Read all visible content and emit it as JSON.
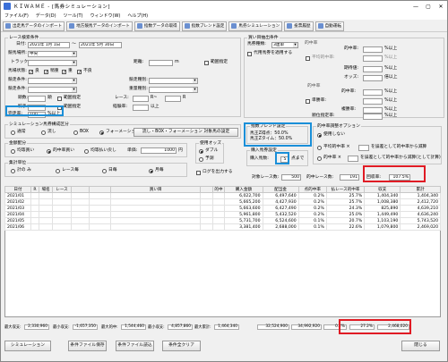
{
  "window": {
    "title": "ＫＩＷＡＭＥ - [馬券シミュレーション]",
    "controls": [
      "—",
      "▢",
      "✕"
    ]
  },
  "menu": [
    "ファイル(F)",
    "データ(D)",
    "ツール(T)",
    "ウィンドウ(W)",
    "ヘルプ(H)"
  ],
  "toolbar": [
    "出走馬データのインポート",
    "地方競馬データのインポート",
    "指数データの取得",
    "指数ブレンド設定",
    "馬券シミュレーション",
    "投票履歴",
    "自動運転"
  ],
  "race": {
    "caption": "レース検索条件",
    "date_label": "日付:",
    "date_from": "2021年 1月 1日",
    "date_to": "2021年 5月 30日",
    "venue_label": "競馬場所:",
    "venue": "中央",
    "track_label": "トラック:",
    "distance_label": "距離:",
    "distance_unit": "m",
    "range": "範囲指定",
    "cond_label": "馬場状態:",
    "cond": [
      "良",
      "稍重",
      "重",
      "不良"
    ],
    "class_label": "競走条件:",
    "grade_label": "競走種別:",
    "weight_label": "重量種別:",
    "age_label": "競走条件:",
    "count_label": "頭数:",
    "head_unit": "頭",
    "race_label": "レース:",
    "race_unit": "R",
    "dash": "R~",
    "jockey_label": "騎手:",
    "jockey_unit": "以上",
    "rest_label": "経験率:",
    "rest_unit": "以上",
    "settle_label": "完走率:",
    "settle_val": "100",
    "settle_unit": "%以上"
  },
  "buy": {
    "caption": "買い目抽出条件",
    "type_label": "馬券種類:",
    "type": "3連単",
    "chk": "代用馬券を適用する",
    "hit_label": "的中率:",
    "hit_unit": "%以上",
    "avg_label": "平均的中率:",
    "avg_unit": "%以上",
    "kitai_label": "期待値:",
    "kitai_unit": "%以上",
    "odds_label": "オッズ:",
    "odds_unit": "倍以上",
    "sub": "的中率",
    "p1": "的中率:",
    "p2": "単勝率:",
    "p3": "複勝率:",
    "p4": "順位指定率:",
    "p_unit": "%以上",
    "p_unit2": "%以上"
  },
  "sim": {
    "caption": "シミュレーション馬券構成区分",
    "opts": [
      "通常",
      "流し",
      "BOX",
      "フォーメーション"
    ],
    "btn": "流し・BOX・フォーメーション 対象馬の設定"
  },
  "blend": {
    "caption": "指数ブレンド設定",
    "l1": "馬王Z得点：50.0%",
    "l2": "馬王Zタイム：50.0%"
  },
  "bet": {
    "caption": "購入馬券設定",
    "label": "購入馬数:",
    "val": "5",
    "unit": "点まで"
  },
  "adj": {
    "caption": "的中率調整オプション",
    "o1": "使用しない",
    "o2": "平均的中率 ×",
    "o2b": "を誤差として的中率から減算",
    "o3": "的中率 ×",
    "o3b": "を誤差として的中率から減算(として計算)"
  },
  "alloc": {
    "caption": "金額配分",
    "opts": [
      "均等買い",
      "的中率買い",
      "均等払い戻し"
    ],
    "unit_label": "単価:",
    "unit": "1000",
    "yen": "円"
  },
  "tally": {
    "caption": "集計単位",
    "opts": [
      "計の み",
      "レース毎",
      "日毎",
      "月毎"
    ]
  },
  "odds": {
    "caption": "使用オッズ",
    "opts": [
      "ダブル",
      "予測"
    ]
  },
  "log": "ログを出力する",
  "stats": {
    "races_label": "対象レース数:",
    "races": "500",
    "hit_label": "的中レース数:",
    "hit": "191",
    "ret_label": "回収率:",
    "ret": "107.5%"
  },
  "grid": {
    "headers": [
      "日付",
      "R",
      "場名",
      "レース",
      "",
      "",
      "買い目",
      "",
      "的中",
      "購入金額",
      "配当金",
      "点的中率",
      "払レース的中率",
      "収支",
      "累計"
    ],
    "rows": [
      [
        "2021/01",
        "",
        "",
        "",
        "",
        "",
        "",
        "",
        "",
        "6,022,700",
        "6,497,640",
        "0.2%",
        "25.7%",
        "1,404,340",
        "1,404,340"
      ],
      [
        "2021/02",
        "",
        "",
        "",
        "",
        "",
        "",
        "",
        "",
        "5,665,200",
        "4,427,930",
        "0.2%",
        "25.7%",
        "1,008,380",
        "2,412,720"
      ],
      [
        "2021/03",
        "",
        "",
        "",
        "",
        "",
        "",
        "",
        "",
        "5,663,600",
        "6,427,490",
        "0.2%",
        "24.3%",
        "825,890",
        "4,639,210"
      ],
      [
        "2021/04",
        "",
        "",
        "",
        "",
        "",
        "",
        "",
        "",
        "5,961,800",
        "5,432,520",
        "0.2%",
        "25.0%",
        "1,449,490",
        "4,636,240"
      ],
      [
        "2021/05",
        "",
        "",
        "",
        "",
        "",
        "",
        "",
        "",
        "5,731,700",
        "6,524,600",
        "0.1%",
        "20.7%",
        "1,103,190",
        "5,743,520"
      ],
      [
        "2021/06",
        "",
        "",
        "",
        "",
        "",
        "",
        "",
        "",
        "3,381,400",
        "2,688,000",
        "0.1%",
        "22.6%",
        "1,079,800",
        "2,469,020"
      ]
    ]
  },
  "summary": {
    "l1": "最大収支:",
    "v1": "2,330,960",
    "l2": "最小収支:",
    "v2": "-1,657,350",
    "l3": "最大的中:",
    "v3": "1,544,460",
    "l4": "最小収支:",
    "v4": "4,857,860",
    "l5": "最大累計:",
    "v5": "1,464,340",
    "t1": "32,524,900",
    "t2": "34,992,920",
    "t3": "0.2%",
    "t4": "27.2%",
    "t5": "2,468,020"
  },
  "buttons": {
    "sim": "シミュレーション",
    "save": "条件ファイル保存",
    "load": "条件ファイル読込",
    "clear": "条件全クリア",
    "close": "閉じる"
  },
  "colors": {
    "highlight_red": "#e01b24",
    "highlight_blue": "#1a8fd8"
  }
}
